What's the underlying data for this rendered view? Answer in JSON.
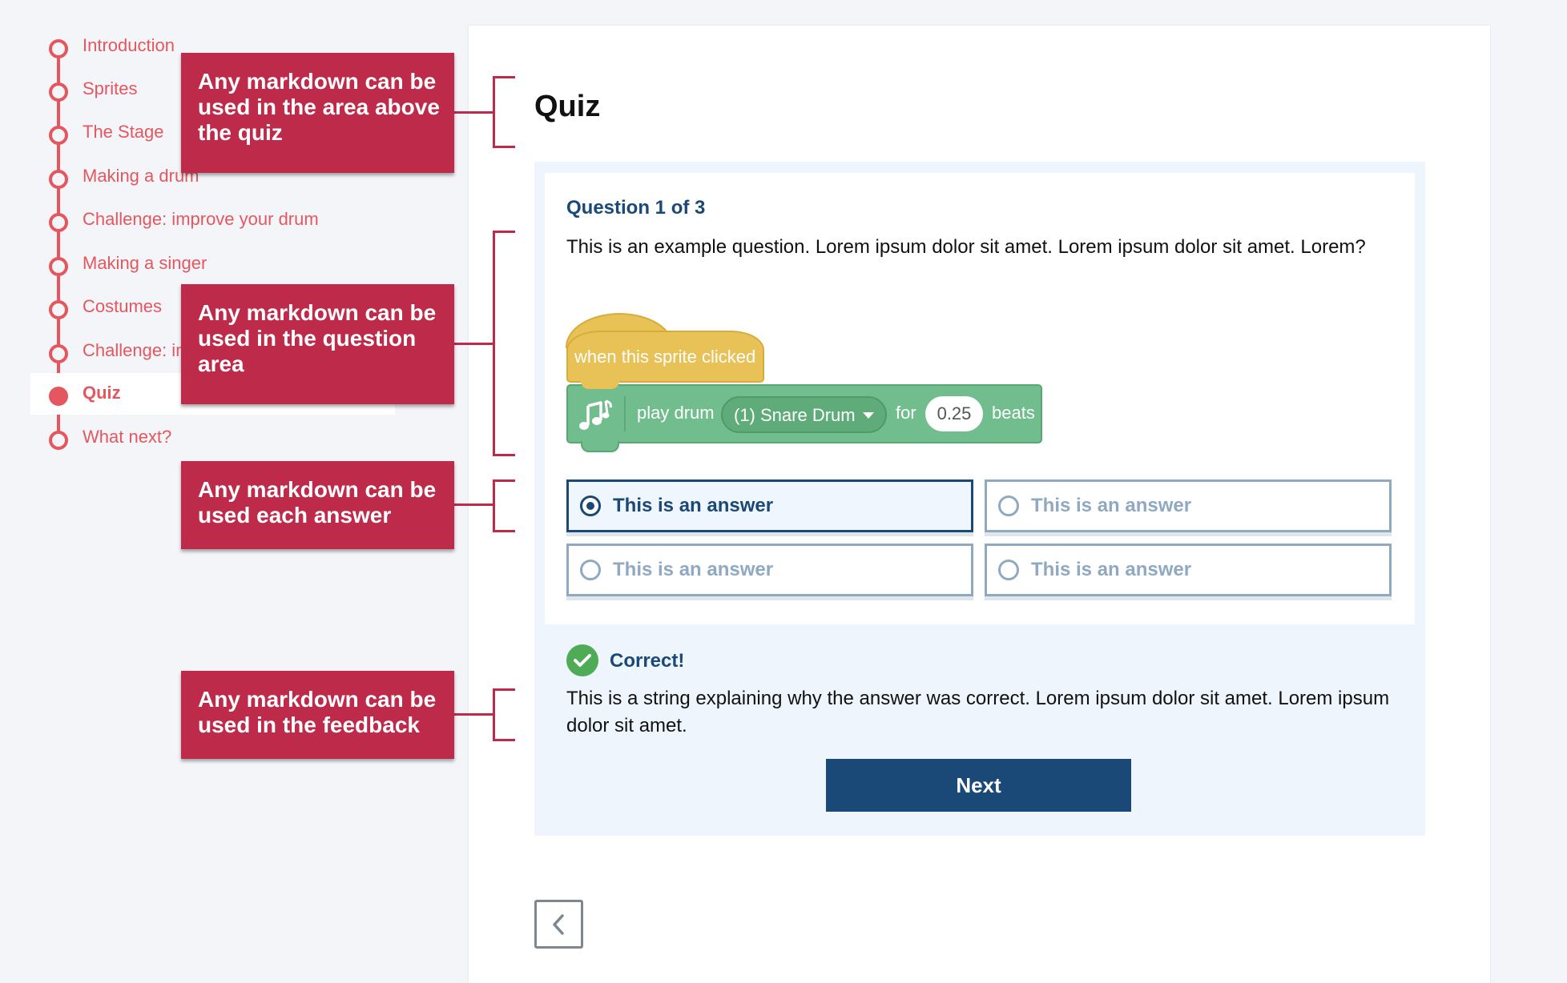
{
  "sidebar": {
    "items": [
      {
        "label": "Introduction"
      },
      {
        "label": "Sprites"
      },
      {
        "label": "The Stage"
      },
      {
        "label": "Making a drum"
      },
      {
        "label": "Challenge: improve your drum"
      },
      {
        "label": "Making a singer"
      },
      {
        "label": "Costumes"
      },
      {
        "label": "Challenge: improve your singer"
      },
      {
        "label": "Quiz",
        "active": true
      },
      {
        "label": "What next?"
      }
    ]
  },
  "annotations": {
    "above_quiz": "Any markdown can be used in the area above the quiz",
    "question": "Any markdown can be used in the question area",
    "answers": "Any markdown can be used each answer",
    "feedback": "Any markdown can be used in the feedback"
  },
  "quiz": {
    "title": "Quiz",
    "question_heading": "Question 1 of 3",
    "question_text": "This is an example question. Lorem ipsum dolor sit amet. Lorem ipsum dolor sit amet. Lorem?",
    "scratch": {
      "hat_label": "when this sprite clicked",
      "play_label": "play drum",
      "drum_option": "(1) Snare Drum",
      "for_label": "for",
      "beats_value": "0.25",
      "beats_label": "beats"
    },
    "answers": [
      {
        "label": "This is an answer",
        "selected": true
      },
      {
        "label": "This is an answer",
        "selected": false
      },
      {
        "label": "This is an answer",
        "selected": false
      },
      {
        "label": "This is an answer",
        "selected": false
      }
    ],
    "feedback": {
      "title": "Correct!",
      "text": "This is a string explaining why the answer was correct. Lorem ipsum dolor sit amet. Lorem ipsum dolor sit amet."
    },
    "next_label": "Next"
  },
  "colors": {
    "accent": "#e5575f",
    "callout": "#bd2a4a",
    "primary": "#1a4877",
    "success": "#4fab56",
    "scratch_events": "#e8c157",
    "scratch_music": "#72bd8d"
  },
  "icons": [
    "music-note-icon",
    "checkmark-icon",
    "chevron-left-icon",
    "radio-icon",
    "dropdown-arrow-icon"
  ]
}
